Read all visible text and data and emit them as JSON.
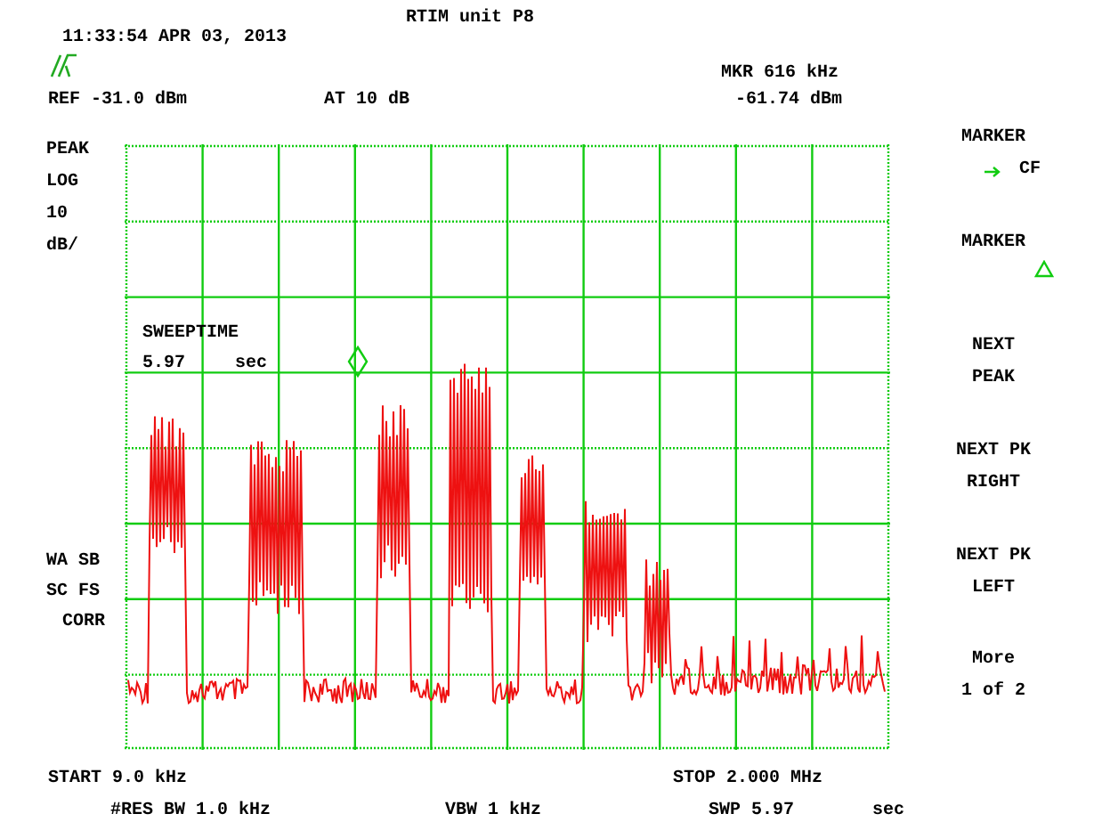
{
  "title": "RTIM unit P8",
  "timestamp": "11:33:54 APR 03, 2013",
  "marker_readout": {
    "frequency": "MKR 616 kHz",
    "amplitude": "-61.74 dBm"
  },
  "reference": "REF -31.0 dBm",
  "attenuation": "AT 10 dB",
  "scale_labels": [
    "PEAK",
    "LOG",
    "10",
    "dB/"
  ],
  "status_labels": [
    "WA SB",
    "SC FS",
    "CORR"
  ],
  "sweeptime": {
    "label": "SWEEPTIME",
    "value": "5.97",
    "unit": "sec"
  },
  "softkeys": [
    {
      "kind": "arrow",
      "label": "MARKER",
      "sub": "CF"
    },
    {
      "kind": "delta",
      "label": "MARKER"
    },
    {
      "kind": "text",
      "label": "NEXT",
      "sub": "PEAK"
    },
    {
      "kind": "text",
      "label": "NEXT PK",
      "sub": "RIGHT"
    },
    {
      "kind": "text",
      "label": "NEXT PK",
      "sub": "LEFT"
    },
    {
      "kind": "text",
      "label": "More",
      "sub": "1 of 2"
    }
  ],
  "start": "START 9.0 kHz",
  "stop": "STOP 2.000 MHz",
  "footer": {
    "rbw": "#RES BW 1.0 kHz",
    "vbw": "VBW 1 kHz",
    "sweep": "SWP 5.97",
    "sweep_unit": "sec"
  }
}
